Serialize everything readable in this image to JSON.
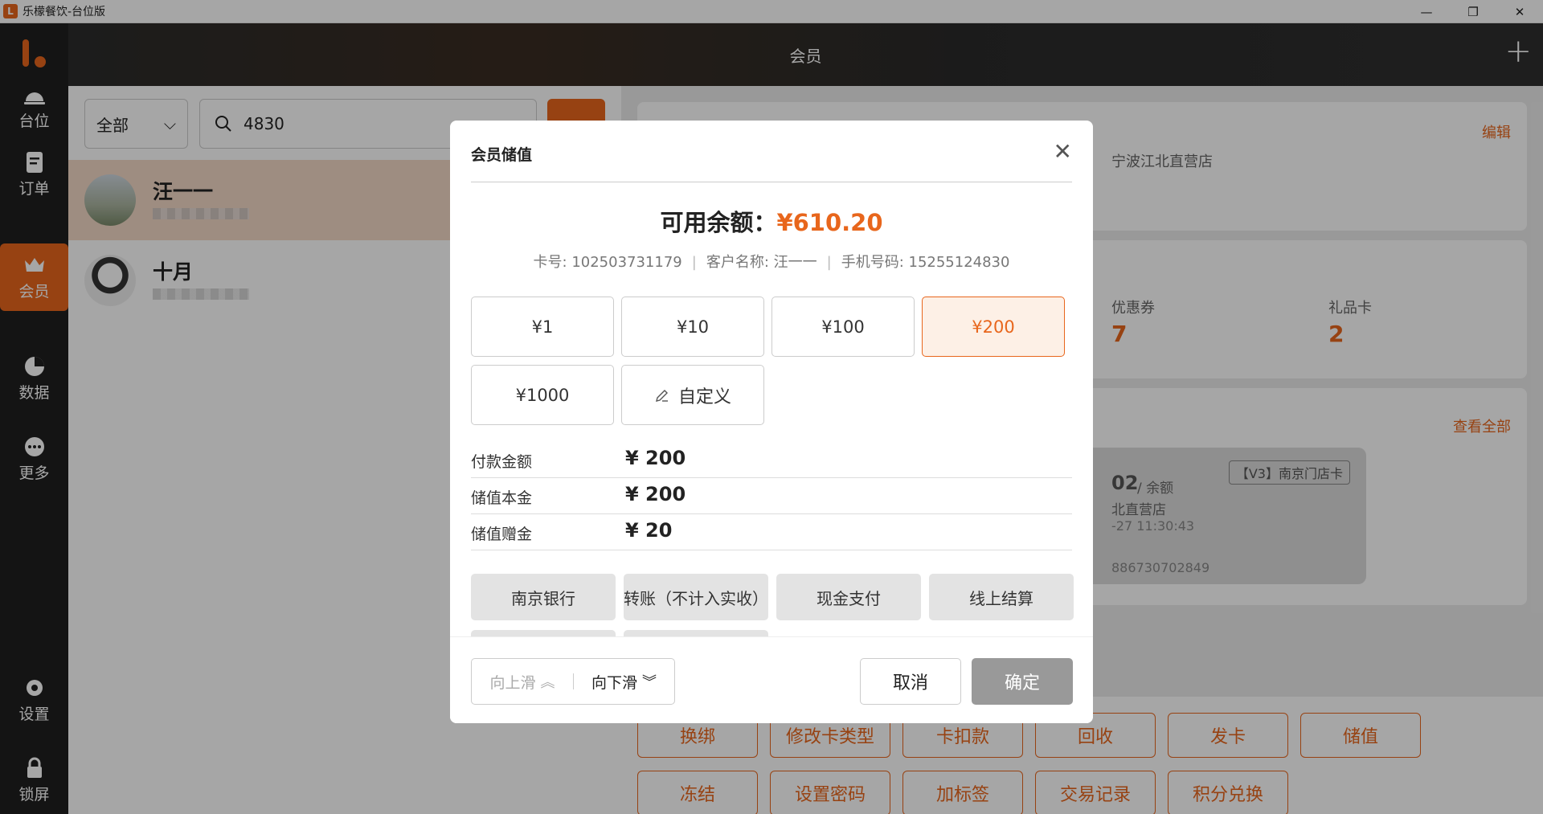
{
  "window": {
    "title": "乐檬餐饮-台位版",
    "minimize": "—",
    "restore": "❐",
    "close": "✕"
  },
  "sidebar": {
    "items": [
      {
        "label": "台位",
        "icon": "table-bell-icon"
      },
      {
        "label": "订单",
        "icon": "order-icon"
      },
      {
        "label": "会员",
        "icon": "member-crown-icon"
      },
      {
        "label": "数据",
        "icon": "pie-chart-icon"
      },
      {
        "label": "更多",
        "icon": "more-dots-icon"
      },
      {
        "label": "设置",
        "icon": "gear-icon"
      },
      {
        "label": "锁屏",
        "icon": "lock-icon"
      }
    ]
  },
  "header": {
    "title": "会员",
    "plus": "+"
  },
  "left": {
    "filter": "全部",
    "search_value": "4830",
    "members": [
      {
        "name": "汪一一"
      },
      {
        "name": "十月"
      }
    ]
  },
  "right": {
    "edit": "编辑",
    "store": "宁波江北直营店",
    "coupon_label": "优惠券",
    "coupon_value": "7",
    "gift_label": "礼品卡",
    "gift_value": "2",
    "view_all": "查看全部",
    "card_amount": "02",
    "card_amount_suffix": "/ 余额",
    "card_store": "北直营店",
    "card_time": "-27 11:30:43",
    "card_tag": "【V3】南京门店卡",
    "card_no": "886730702849",
    "actions_row1": [
      "换绑",
      "修改卡类型",
      "卡扣款",
      "回收",
      "发卡",
      "储值"
    ],
    "actions_row2": [
      "冻结",
      "设置密码",
      "加标签",
      "交易记录",
      "积分兑换"
    ]
  },
  "dialog": {
    "title": "会员储值",
    "close": "✕",
    "balance_label": "可用余额：",
    "balance_value": "¥610.20",
    "card_no": "卡号: 102503731179",
    "customer": "客户名称: 汪一一",
    "phone": "手机号码: 15255124830",
    "amounts": [
      "¥1",
      "¥10",
      "¥100",
      "¥200",
      "¥1000"
    ],
    "selected_amount": "¥200",
    "custom_label": "自定义",
    "rows": [
      {
        "label": "付款金额",
        "value": "¥ 200"
      },
      {
        "label": "储值本金",
        "value": "¥ 200"
      },
      {
        "label": "储值赠金",
        "value": "¥ 20"
      }
    ],
    "payments": [
      "南京银行",
      "转账（不计入实收）",
      "现金支付",
      "线上结算"
    ],
    "scroll_up": "向上滑",
    "scroll_down": "向下滑",
    "cancel": "取消",
    "confirm": "确定"
  },
  "colors": {
    "accent": "#e8661c",
    "sidebar_bg": "#1f1f1f",
    "disabled": "#999999"
  }
}
